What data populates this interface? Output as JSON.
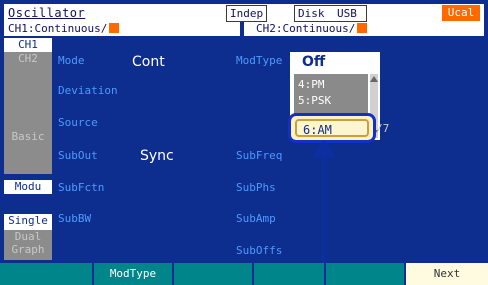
{
  "status": {
    "title": "Oscillator",
    "indep": "Indep",
    "disk": "Disk",
    "usb": "USB",
    "ucal": "Ucal"
  },
  "ch1_bar": "CH1:Continuous/",
  "ch2_bar": "CH2:Continuous/",
  "side": {
    "ch1": "CH1",
    "ch2": "CH2",
    "basic": "Basic",
    "modu": "Modu",
    "single": "Single",
    "dual": "Dual",
    "graph": "Graph"
  },
  "labels": {
    "mode": "Mode",
    "deviation": "Deviation",
    "source": "Source",
    "subout": "SubOut",
    "subfctn": "SubFctn",
    "subbw": "SubBW",
    "modtype": "ModType",
    "subfreq": "SubFreq",
    "subphs": "SubPhs",
    "subamp": "SubAmp",
    "suboffs": "SubOffs"
  },
  "values": {
    "mode": "Cont",
    "subout": "Sync"
  },
  "dropdown": {
    "selected": "Off",
    "items": [
      "4:PM",
      "5:PSK"
    ],
    "highlighted": "6:AM",
    "hidden_suffix": "/7"
  },
  "softkeys": [
    "",
    "ModType",
    "",
    "",
    "",
    "Next"
  ]
}
